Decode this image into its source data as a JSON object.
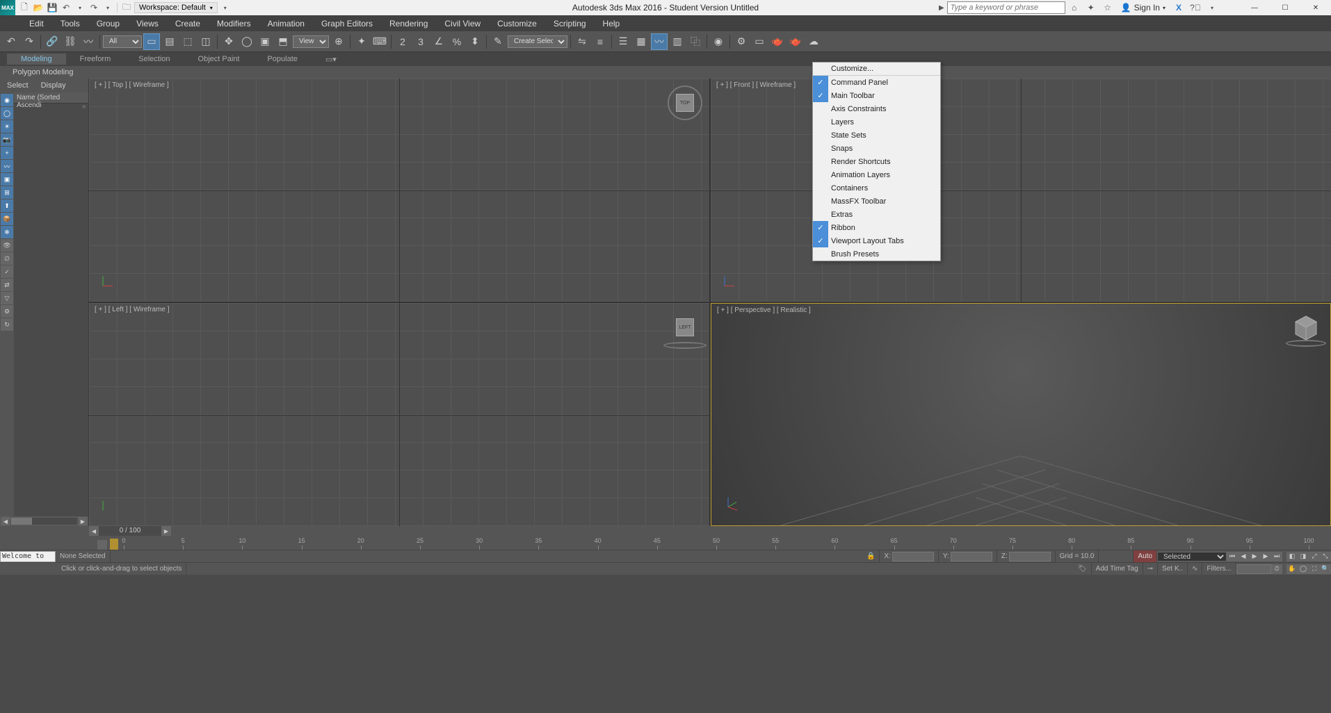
{
  "titlebar": {
    "app_label": "MAX",
    "workspace_label": "Workspace: Default",
    "title": "Autodesk 3ds Max 2016 - Student Version   Untitled",
    "search_placeholder": "Type a keyword or phrase",
    "signin": "Sign In"
  },
  "menubar": [
    "Edit",
    "Tools",
    "Group",
    "Views",
    "Create",
    "Modifiers",
    "Animation",
    "Graph Editors",
    "Rendering",
    "Civil View",
    "Customize",
    "Scripting",
    "Help"
  ],
  "toolbar": {
    "filter_combo": "All",
    "view_combo": "View",
    "named_sel": "Create Selection S"
  },
  "ribbon": {
    "tabs": [
      "Modeling",
      "Freeform",
      "Selection",
      "Object Paint",
      "Populate"
    ],
    "panel": "Polygon Modeling"
  },
  "scene_explorer": {
    "tabs": [
      "Select",
      "Display"
    ],
    "header": "Name (Sorted Ascendi"
  },
  "viewports": {
    "top": "[ + ] [ Top ] [ Wireframe ]",
    "front": "[ + ] [ Front ] [ Wireframe ]",
    "left": "[ + ] [ Left ] [ Wireframe ]",
    "perspective": "[ + ] [ Perspective ] [ Realistic ]",
    "cube_top": "TOP",
    "cube_left": "LEFT"
  },
  "timeline": {
    "counter": "0 / 100",
    "ticks": [
      0,
      5,
      10,
      15,
      20,
      25,
      30,
      35,
      40,
      45,
      50,
      55,
      60,
      65,
      70,
      75,
      80,
      85,
      90,
      95,
      100
    ]
  },
  "status": {
    "selection": "None Selected",
    "prompt": "Click or click-and-drag to select objects",
    "welcome": "Welcome to",
    "x_label": "X:",
    "y_label": "Y:",
    "z_label": "Z:",
    "grid": "Grid = 10.0",
    "add_time_tag": "Add Time Tag",
    "auto": "Auto",
    "setk": "Set K..",
    "selected": "Selected",
    "filters": "Filters..."
  },
  "context_menu": {
    "items": [
      {
        "label": "Customize...",
        "checked": false,
        "sep": true
      },
      {
        "label": "Command Panel",
        "checked": true
      },
      {
        "label": "Main Toolbar",
        "checked": true
      },
      {
        "label": "Axis Constraints",
        "checked": false
      },
      {
        "label": "Layers",
        "checked": false
      },
      {
        "label": "State Sets",
        "checked": false
      },
      {
        "label": "Snaps",
        "checked": false
      },
      {
        "label": "Render Shortcuts",
        "checked": false
      },
      {
        "label": "Animation Layers",
        "checked": false
      },
      {
        "label": "Containers",
        "checked": false
      },
      {
        "label": "MassFX Toolbar",
        "checked": false
      },
      {
        "label": "Extras",
        "checked": false
      },
      {
        "label": "Ribbon",
        "checked": true
      },
      {
        "label": "Viewport Layout Tabs",
        "checked": true
      },
      {
        "label": "Brush Presets",
        "checked": false
      }
    ]
  }
}
